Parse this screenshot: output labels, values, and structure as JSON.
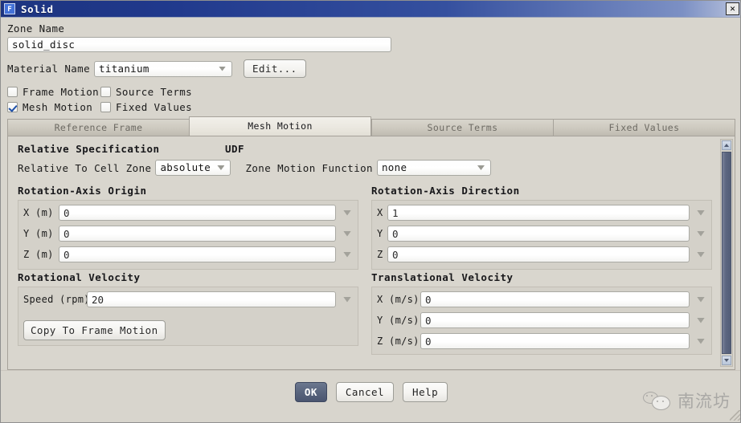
{
  "window": {
    "title": "Solid",
    "app_icon": "fluent-f-icon",
    "close_label": "✕"
  },
  "form": {
    "zone_name_label": "Zone Name",
    "zone_name_value": "solid_disc",
    "material_name_label": "Material Name",
    "material_name_value": "titanium",
    "edit_button": "Edit...",
    "checkboxes": [
      {
        "label": "Frame Motion",
        "checked": false
      },
      {
        "label": "Source Terms",
        "checked": false
      },
      {
        "label": "Mesh Motion",
        "checked": true
      },
      {
        "label": "Fixed Values",
        "checked": false
      }
    ]
  },
  "tabs": [
    {
      "label": "Reference Frame",
      "active": false
    },
    {
      "label": "Mesh Motion",
      "active": true
    },
    {
      "label": "Source Terms",
      "active": false
    },
    {
      "label": "Fixed Values",
      "active": false
    }
  ],
  "mesh_motion": {
    "relative_specification": {
      "group_title": "Relative Specification",
      "field_label": "Relative To Cell Zone",
      "value": "absolute"
    },
    "udf": {
      "group_title": "UDF",
      "field_label": "Zone Motion Function",
      "value": "none"
    },
    "rotation_axis_origin": {
      "group_title": "Rotation-Axis Origin",
      "rows": [
        {
          "label": "X (m)",
          "value": "0"
        },
        {
          "label": "Y (m)",
          "value": "0"
        },
        {
          "label": "Z (m)",
          "value": "0"
        }
      ]
    },
    "rotation_axis_direction": {
      "group_title": "Rotation-Axis Direction",
      "rows": [
        {
          "label": "X",
          "value": "1"
        },
        {
          "label": "Y",
          "value": "0"
        },
        {
          "label": "Z",
          "value": "0"
        }
      ]
    },
    "rotational_velocity": {
      "group_title": "Rotational Velocity",
      "speed_label": "Speed (rpm)",
      "speed_value": "20",
      "copy_button": "Copy To Frame Motion"
    },
    "translational_velocity": {
      "group_title": "Translational Velocity",
      "rows": [
        {
          "label": "X (m/s)",
          "value": "0"
        },
        {
          "label": "Y (m/s)",
          "value": "0"
        },
        {
          "label": "Z (m/s)",
          "value": "0"
        }
      ]
    }
  },
  "footer": {
    "ok": "OK",
    "cancel": "Cancel",
    "help": "Help"
  },
  "watermark": {
    "text": "南流坊",
    "logo": "wechat-bubbles-icon"
  },
  "colors": {
    "titlebar_start": "#1d3480",
    "titlebar_end": "#b9c3dd",
    "panel_bg": "#d8d5cd",
    "accent_primary": "#57637c",
    "checkmark": "#1d4fa8",
    "scrollbar_thumb": "#5d6781"
  }
}
